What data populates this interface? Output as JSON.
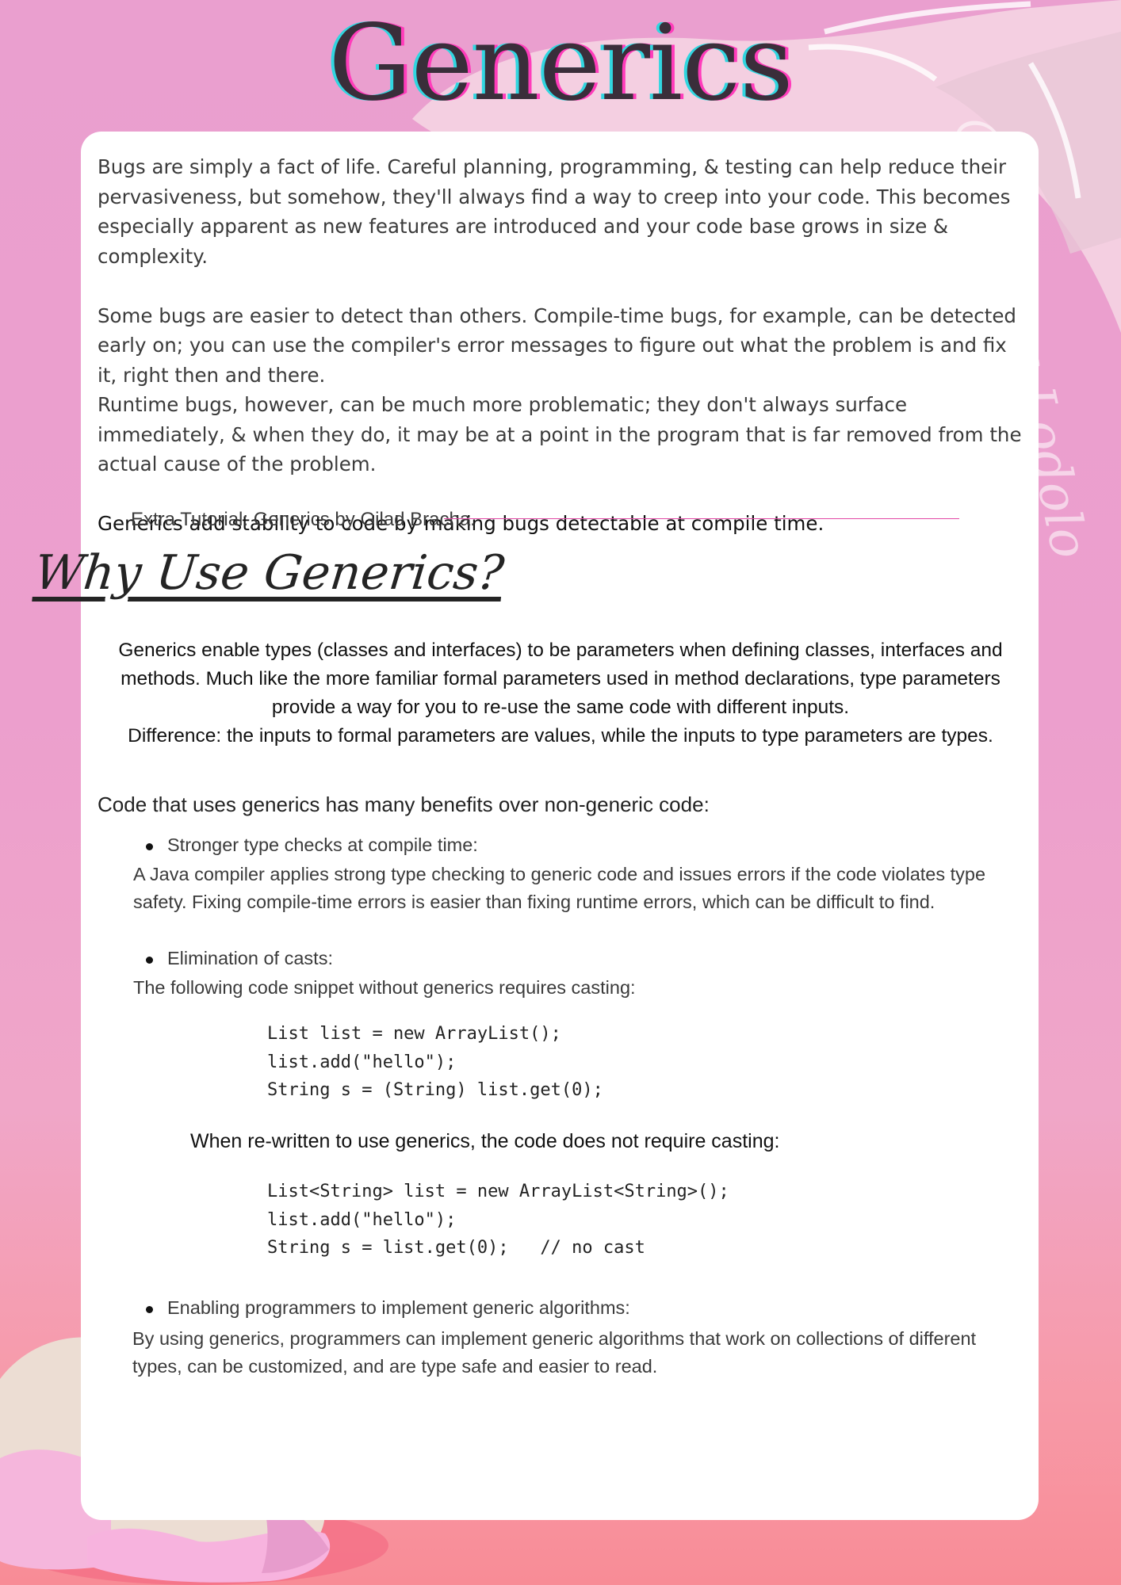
{
  "title": "Generics",
  "watermark": "@Kaamna Lodolo",
  "intro": {
    "p1": "Bugs are simply a fact of life. Careful planning, programming, & testing can help reduce their pervasiveness, but somehow, they'll always find a way to creep into your code. This becomes especially apparent as new features are introduced and your code base grows in size & complexity.",
    "p2": "Some bugs are easier to detect than others. Compile-time bugs, for example, can be detected early on; you can use the compiler's error messages to figure out what the problem is and fix it, right then and there.",
    "p3": "Runtime bugs, however, can be much more problematic; they don't always surface immediately, & when they do, it may be at a point in the program that is far removed from the actual cause of the problem.",
    "lead": "Generics add stability to code by making bugs detectable at compile time."
  },
  "extra_tutorial": "Extra Tutorial: Generics by Gilad Bracha.",
  "why_heading": "Why Use Generics?",
  "why": {
    "p1": "Generics enable types (classes and interfaces) to be parameters when defining classes, interfaces and methods. Much like the more familiar formal parameters used in method declarations, type parameters provide a way for you to re-use the same code with different inputs.",
    "p2": "Difference: the inputs to formal parameters are values, while the inputs to type parameters are types."
  },
  "benefits_heading": "Code that uses generics has many benefits over non-generic code:",
  "benefits": [
    {
      "title": "Stronger type checks at compile time:",
      "text": "A Java compiler applies strong type checking to generic code and issues errors if the code violates type safety. Fixing compile-time errors is easier than fixing runtime errors, which can be difficult to find."
    },
    {
      "title": "Elimination of casts:",
      "text": "The following code snippet without generics requires casting:"
    },
    {
      "title": "Enabling programmers to implement generic algorithms:",
      "text": "By using generics, programmers can implement generic algorithms that work on collections of different types, can be customized, and are type safe and easier to read."
    }
  ],
  "code1": "List list = new ArrayList();\nlist.add(\"hello\");\nString s = (String) list.get(0);",
  "rewrite_text": "When re-written to use generics, the code does not require casting:",
  "code2": "List<String> list = new ArrayList<String>();\nlist.add(\"hello\");\nString s = list.get(0);   // no cast",
  "colors": {
    "background_top": "#ea9fcf",
    "background_bottom": "#f88c96",
    "card": "#ffffff",
    "accent_line": "#e24aa6",
    "title_cyan": "#31d6e0",
    "title_magenta": "#ff3cbb"
  }
}
